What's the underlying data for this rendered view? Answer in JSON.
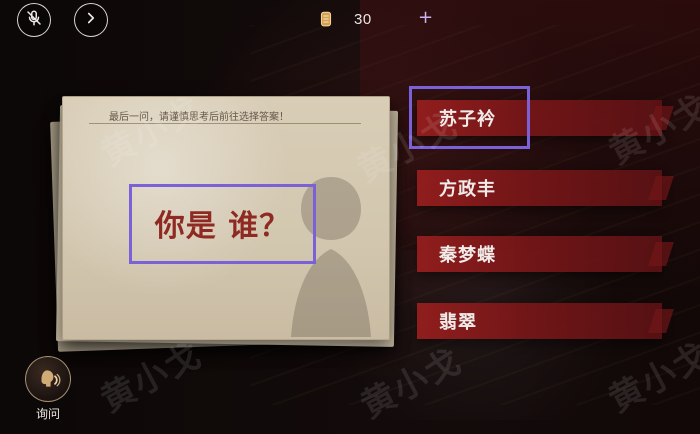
{
  "top_bar": {
    "mute_icon": "mic-off-icon",
    "next_icon": "chevron-right-icon",
    "currency_icon": "coin-icon",
    "currency_amount": "30",
    "plus_label": "+"
  },
  "question_card": {
    "hint_text": "最后一问，请谨慎思考后前往选择答案！",
    "question": "你是 谁？"
  },
  "answers": [
    {
      "label": "苏子衿",
      "selected": true
    },
    {
      "label": "方政丰",
      "selected": false
    },
    {
      "label": "秦梦蝶",
      "selected": false
    },
    {
      "label": "翡翠",
      "selected": false
    }
  ],
  "bottom_left": {
    "ask_icon": "speaking-head-icon",
    "ask_label": "询问"
  },
  "watermark": {
    "text": "黄小戈"
  },
  "colors": {
    "highlight_outline": "#7b61d8",
    "answer_red": "#8f1e1f",
    "paper": "#d6cbb3",
    "question_red": "#8f2a22"
  }
}
